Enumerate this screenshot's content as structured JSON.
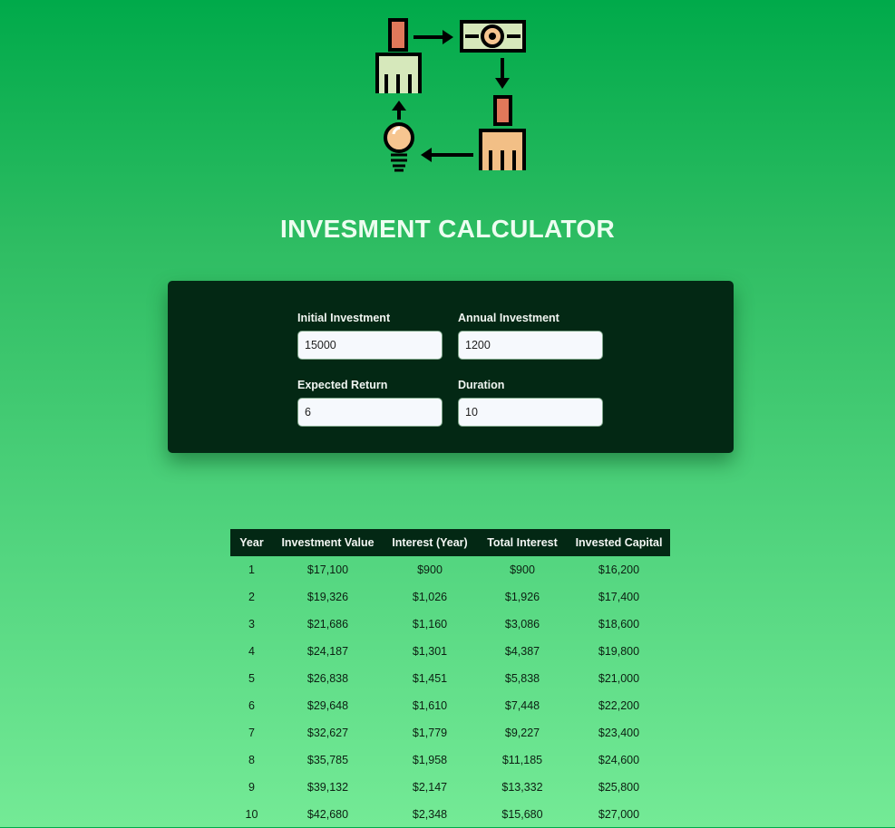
{
  "header": {
    "title": "INVESMENT CALCULATOR",
    "logo_icon": "investment-cycle-icon"
  },
  "inputs": {
    "initial_investment": {
      "label": "Initial Investment",
      "value": "15000"
    },
    "annual_investment": {
      "label": "Annual Investment",
      "value": "1200"
    },
    "expected_return": {
      "label": "Expected Return",
      "value": "6"
    },
    "duration": {
      "label": "Duration",
      "value": "10"
    }
  },
  "table": {
    "headers": [
      "Year",
      "Investment Value",
      "Interest (Year)",
      "Total Interest",
      "Invested Capital"
    ],
    "rows": [
      [
        "1",
        "$17,100",
        "$900",
        "$900",
        "$16,200"
      ],
      [
        "2",
        "$19,326",
        "$1,026",
        "$1,926",
        "$17,400"
      ],
      [
        "3",
        "$21,686",
        "$1,160",
        "$3,086",
        "$18,600"
      ],
      [
        "4",
        "$24,187",
        "$1,301",
        "$4,387",
        "$19,800"
      ],
      [
        "5",
        "$26,838",
        "$1,451",
        "$5,838",
        "$21,000"
      ],
      [
        "6",
        "$29,648",
        "$1,610",
        "$7,448",
        "$22,200"
      ],
      [
        "7",
        "$32,627",
        "$1,779",
        "$9,227",
        "$23,400"
      ],
      [
        "8",
        "$35,785",
        "$1,958",
        "$11,185",
        "$24,600"
      ],
      [
        "9",
        "$39,132",
        "$2,147",
        "$13,332",
        "$25,800"
      ],
      [
        "10",
        "$42,680",
        "$2,348",
        "$15,680",
        "$27,000"
      ]
    ]
  },
  "colors": {
    "panel": "#032814",
    "title_text": "#ecfdf0",
    "gradient_top": "#00aa4a",
    "gradient_bottom": "#74ea96"
  }
}
